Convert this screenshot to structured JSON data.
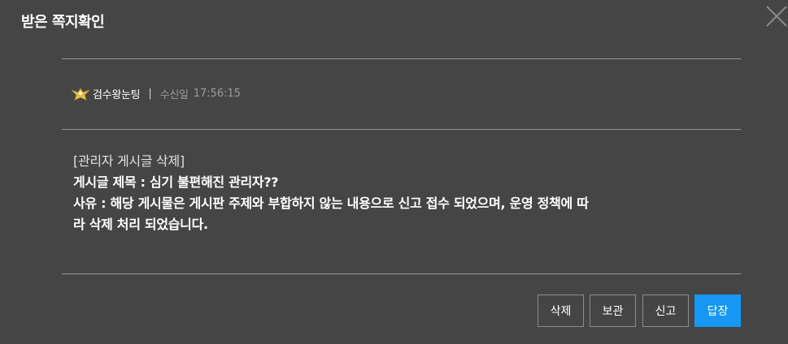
{
  "dialog": {
    "title": "받은 쪽지확인",
    "close_icon": "close-icon"
  },
  "meta": {
    "badge_icon": "rank-badge-icon",
    "sender": "검수왕눈팅",
    "separator": "|",
    "received_label": "수신일",
    "received_time": "17:56:15"
  },
  "message": {
    "line1": "[관리자 게시글 삭제]",
    "line2": "게시글 제목 : 심기 불편해진 관리자??",
    "line3": "사유 : 해당 게시물은 게시판 주제와 부합하지 않는 내용으로 신고 접수 되었으며, 운영 정책에 따",
    "line4": "라 삭제 처리 되었습니다."
  },
  "buttons": {
    "delete": "삭제",
    "save": "보관",
    "report": "신고",
    "reply": "답장"
  },
  "colors": {
    "background": "#454545",
    "reply_button": "#1597f3",
    "divider": "#9a9a9a"
  }
}
